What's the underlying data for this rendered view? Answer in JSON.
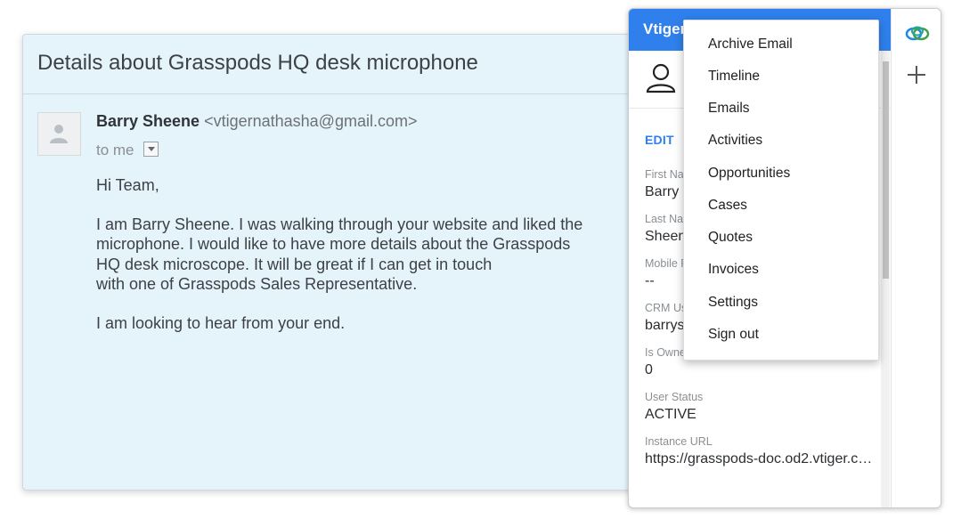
{
  "email": {
    "subject": "Details about Grasspods HQ desk microphone",
    "sender_name": "Barry Sheene",
    "sender_email": "<vtigernathasha@gmail.com>",
    "recipient": "to me",
    "greeting": "Hi Team,",
    "body_paragraph": "I am Barry Sheene. I was walking through your website and liked the\nmicrophone. I would like to have more details about the Grasspods\nHQ desk microscope. It will be great if I can get in touch\nwith one of Grasspods Sales Representative.",
    "closing": "I am looking to hear from your end."
  },
  "panel": {
    "header_title": "Vtiger",
    "edit_label": "EDIT",
    "fields": [
      {
        "label": "First Na",
        "value": "Barry"
      },
      {
        "label": "Last Nam",
        "value": "Sheene"
      },
      {
        "label": "Mobile P",
        "value": "--"
      },
      {
        "label": "CRM Us",
        "value": "barrysh"
      },
      {
        "label": "Is Owne",
        "value": "0"
      },
      {
        "label": "User Status",
        "value": "ACTIVE"
      },
      {
        "label": "Instance URL",
        "value": "https://grasspods-doc.od2.vtiger.c…"
      }
    ]
  },
  "menu": {
    "items": [
      "Archive Email",
      "Timeline",
      "Emails",
      "Activities",
      "Opportunities",
      "Cases",
      "Quotes",
      "Invoices",
      "Settings",
      "Sign out"
    ]
  },
  "icons": {
    "rail_logo": "vtiger-logo-icon",
    "rail_add": "plus-icon",
    "profile": "user-icon",
    "sender_avatar": "avatar-placeholder-icon"
  },
  "colors": {
    "accent": "#2f80ed",
    "email_background": "#e5f3fb"
  }
}
